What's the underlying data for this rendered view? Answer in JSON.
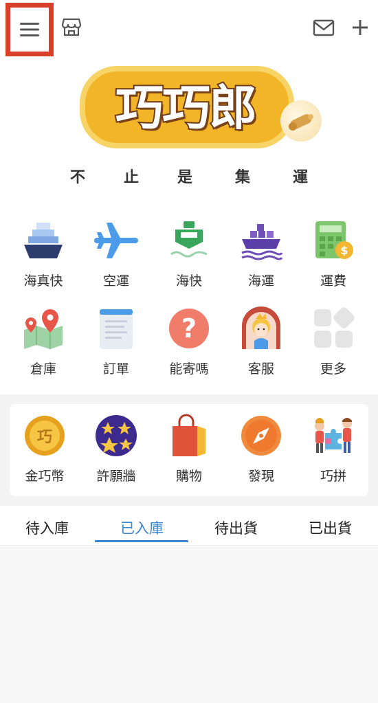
{
  "header": {
    "menu_icon": "hamburger-menu-icon",
    "store_icon": "store-icon",
    "mail_icon": "mail-icon",
    "add_icon": "plus-icon",
    "highlight_color": "#d9402b"
  },
  "brand": {
    "logo_text": "巧巧郎",
    "slogan": [
      "不",
      "止",
      "是",
      "集",
      "運"
    ]
  },
  "services_row1": [
    {
      "label": "海真快",
      "icon": "ship-icon"
    },
    {
      "label": "空運",
      "icon": "airplane-icon"
    },
    {
      "label": "海快",
      "icon": "boat-icon"
    },
    {
      "label": "海運",
      "icon": "cargo-ship-icon"
    },
    {
      "label": "運費",
      "icon": "calculator-icon"
    }
  ],
  "services_row2": [
    {
      "label": "倉庫",
      "icon": "map-pin-icon"
    },
    {
      "label": "訂單",
      "icon": "document-icon"
    },
    {
      "label": "能寄嗎",
      "icon": "question-icon"
    },
    {
      "label": "客服",
      "icon": "customer-service-icon"
    },
    {
      "label": "更多",
      "icon": "more-grid-icon"
    }
  ],
  "features": [
    {
      "label": "金巧幣",
      "icon": "coin-icon"
    },
    {
      "label": "許願牆",
      "icon": "star-wall-icon"
    },
    {
      "label": "購物",
      "icon": "shopping-bag-icon"
    },
    {
      "label": "發現",
      "icon": "compass-icon"
    },
    {
      "label": "巧拼",
      "icon": "puzzle-icon"
    }
  ],
  "tabs": {
    "items": [
      "待入庫",
      "已入庫",
      "待出貨",
      "已出貨"
    ],
    "active": "已入庫",
    "active_color": "#3a86cf"
  }
}
